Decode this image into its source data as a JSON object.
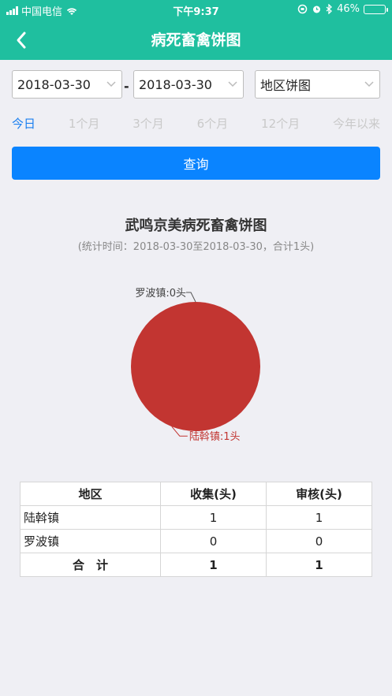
{
  "status_bar": {
    "carrier": "中国电信",
    "time": "下午9:37",
    "battery": "46%",
    "battery_level": 0.46
  },
  "nav": {
    "title": "病死畜禽饼图",
    "back_icon": "chevron-left-icon"
  },
  "filters": {
    "start_date": "2018-03-30",
    "separator": "-",
    "end_date": "2018-03-30",
    "chart_type": "地区饼图"
  },
  "ranges": [
    "今日",
    "1个月",
    "3个月",
    "6个月",
    "12个月",
    "今年以来"
  ],
  "active_range": 0,
  "query_label": "查询",
  "colors": {
    "header": "#1fbf9f",
    "primary_button": "#0a84ff",
    "active_range": "#1a7ff0",
    "pie_slice": "#c23531"
  },
  "chart_data": {
    "type": "pie",
    "title": "武鸣京美病死畜禽饼图",
    "subtitle": "(统计时间：2018-03-30至2018-03-30，合计1头)",
    "slices": [
      {
        "label": "罗波镇:0头",
        "name": "罗波镇",
        "value": 0
      },
      {
        "label": "陆斡镇:1头",
        "name": "陆斡镇",
        "value": 1
      }
    ]
  },
  "table": {
    "headers": [
      "地区",
      "收集(头)",
      "审核(头)"
    ],
    "rows": [
      {
        "region": "陆斡镇",
        "collect": "1",
        "review": "1"
      },
      {
        "region": "罗波镇",
        "collect": "0",
        "review": "0"
      }
    ],
    "total": {
      "label": "合　计",
      "collect": "1",
      "review": "1"
    }
  }
}
